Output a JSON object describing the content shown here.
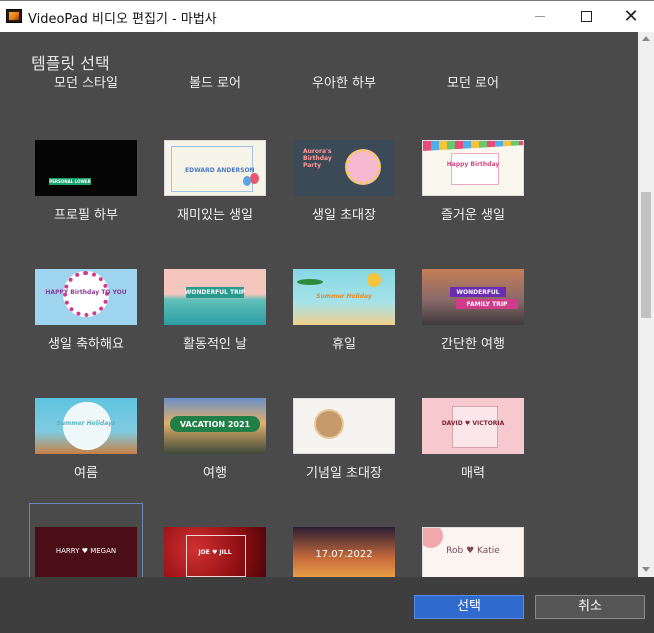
{
  "window": {
    "title": "VideoPad 비디오 편집기 - 마법사",
    "minimize": "–",
    "close": "✕"
  },
  "section_title": "템플릿 선택",
  "templates": [
    {
      "label": "모던 스타일"
    },
    {
      "label": "볼드 로어"
    },
    {
      "label": "우아한 하부"
    },
    {
      "label": "모던 로어"
    },
    {
      "label": "프로필 하부"
    },
    {
      "label": "재미있는 생일"
    },
    {
      "label": "생일 초대장"
    },
    {
      "label": "즐거운 생일"
    },
    {
      "label": "생일 축하해요"
    },
    {
      "label": "활동적인 날"
    },
    {
      "label": "휴일"
    },
    {
      "label": "간단한 여행"
    },
    {
      "label": "여름"
    },
    {
      "label": "여행"
    },
    {
      "label": "기념일 초대장"
    },
    {
      "label": "매력"
    },
    {
      "label": ""
    },
    {
      "label": ""
    },
    {
      "label": ""
    },
    {
      "label": ""
    }
  ],
  "thumb_text": {
    "black": "PERSONAL LOWER",
    "party": "EDWARD ANDERSON",
    "invite": "Aurora's Birthday Party",
    "flags": "Happy Birthday",
    "bday": "HAPPY Birthday TO YOU",
    "beach": "WONDERFUL TRIP",
    "holiday": "Summer Holiday",
    "family1": "WONDERFUL",
    "family2": "FAMILY TRIP",
    "summer": "Summer Holidays",
    "vacation": "VACATION 2021",
    "charm": "DAVID ♥ VICTORIA",
    "wedding1": "HARRY ♥ MEGAN",
    "wedding2": "JOE ♥ JILL",
    "sunset": "17.07.2022",
    "floral": "Rob ♥ Katie"
  },
  "buttons": {
    "select": "선택",
    "cancel": "취소"
  }
}
